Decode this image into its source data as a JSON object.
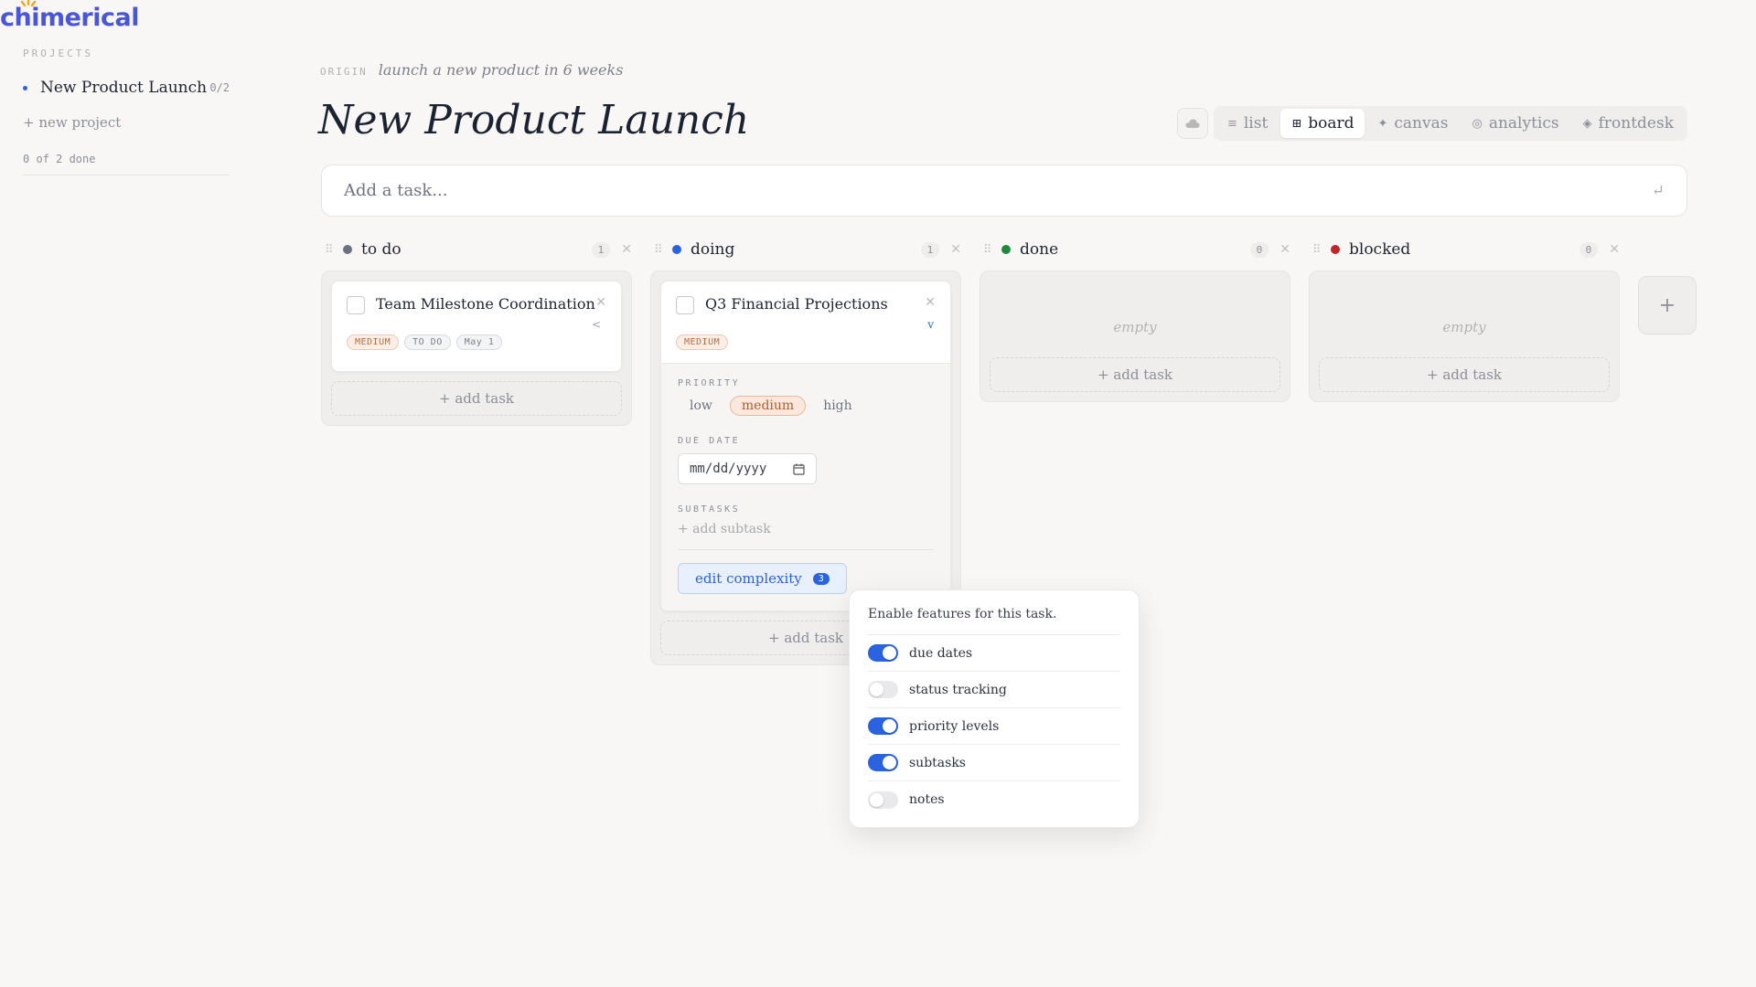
{
  "brand": {
    "logo_text": "chimerical",
    "accent": "#4a56d8",
    "sun_color": "#f2a61f"
  },
  "sidebar": {
    "heading": "PROJECTS",
    "projects": [
      {
        "name": "New Product Launch",
        "count": "0/2"
      }
    ],
    "new_project": "+ new project",
    "progress": "0 of 2 done"
  },
  "header": {
    "origin_label": "ORIGIN",
    "origin_text": "launch a new product in 6 weeks",
    "title": "New Product Launch",
    "cloud_icon": "cloud-icon",
    "views": [
      {
        "label": "list",
        "icon": "≡",
        "active": false
      },
      {
        "label": "board",
        "icon": "⊞",
        "active": true
      },
      {
        "label": "canvas",
        "icon": "✦",
        "active": false
      },
      {
        "label": "analytics",
        "icon": "◎",
        "active": false
      },
      {
        "label": "frontdesk",
        "icon": "◈",
        "active": false
      }
    ]
  },
  "add_task_bar": {
    "placeholder": "Add a task...",
    "enter_icon": "↵"
  },
  "columns": [
    {
      "title": "to do",
      "count": "1",
      "color": "#6b7280",
      "add_label": "+ add task",
      "cards": [
        {
          "title": "Team Milestone Coordination",
          "toggle": "<",
          "tags": [
            "MEDIUM",
            "TO DO",
            "May 1"
          ]
        }
      ]
    },
    {
      "title": "doing",
      "count": "1",
      "color": "#2a62e0",
      "add_label": "+ add task",
      "cards": [
        {
          "title": "Q3 Financial Projections",
          "toggle": "v",
          "tags": [
            "MEDIUM"
          ]
        }
      ]
    },
    {
      "title": "done",
      "count": "0",
      "color": "#1e8a3e",
      "add_label": "+ add task",
      "empty": "empty"
    },
    {
      "title": "blocked",
      "count": "0",
      "color": "#c0262d",
      "add_label": "+ add task",
      "empty": "empty"
    }
  ],
  "add_column": "+",
  "expanded_card": {
    "priority_label": "PRIORITY",
    "priorities": [
      "low",
      "medium",
      "high"
    ],
    "selected_priority": "medium",
    "due_label": "DUE DATE",
    "due_placeholder": "mm/dd/yyyy",
    "subtasks_label": "SUBTASKS",
    "add_subtask": "+ add subtask",
    "complexity_label": "edit complexity",
    "complexity_count": "3"
  },
  "popover": {
    "title": "Enable features for this task.",
    "features": [
      {
        "label": "due dates",
        "on": true
      },
      {
        "label": "status tracking",
        "on": false
      },
      {
        "label": "priority levels",
        "on": true
      },
      {
        "label": "subtasks",
        "on": true
      },
      {
        "label": "notes",
        "on": false
      }
    ]
  }
}
